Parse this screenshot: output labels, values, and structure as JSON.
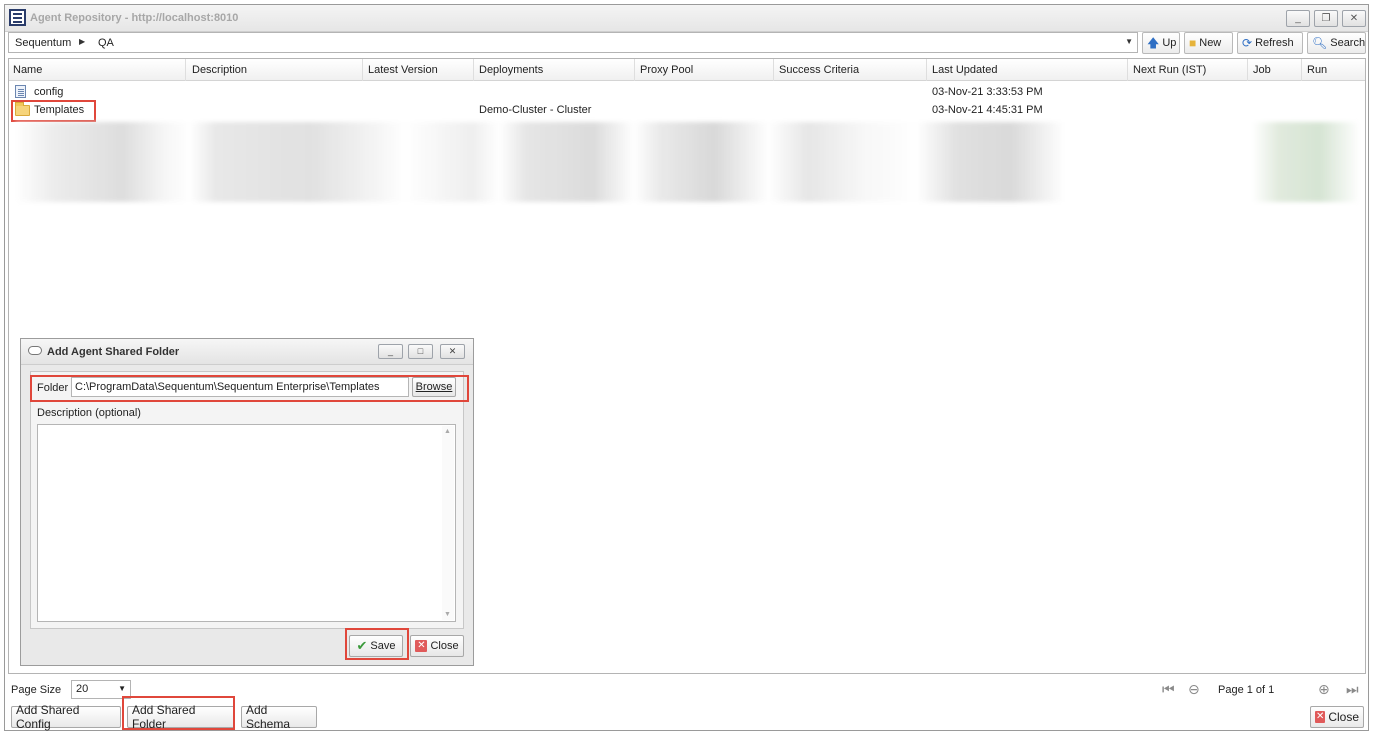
{
  "window": {
    "title": "Agent Repository - http://localhost:8010",
    "controls": [
      "_",
      "❐",
      "✕"
    ]
  },
  "breadcrumb": {
    "root": "Sequentum",
    "current": "QA"
  },
  "toolbar": {
    "up": "Up",
    "new": "New",
    "refresh": "Refresh",
    "search": "Search"
  },
  "grid": {
    "columns": [
      "Name",
      "Description",
      "Latest Version",
      "Deployments",
      "Proxy Pool",
      "Success Criteria",
      "Last Updated",
      "Next Run (IST)",
      "Job",
      "Run"
    ],
    "rows": [
      {
        "name": "config",
        "deployments": "",
        "last_updated": "03-Nov-21 3:33:53 PM",
        "icon": "file-icon"
      },
      {
        "name": "Templates",
        "deployments": "Demo-Cluster - Cluster",
        "last_updated": "03-Nov-21 4:45:31 PM",
        "icon": "folder-icon"
      }
    ]
  },
  "dialog": {
    "title": "Add Agent Shared Folder",
    "folder_label": "Folder",
    "folder_value": "C:\\ProgramData\\Sequentum\\Sequentum Enterprise\\Templates",
    "browse": "Browse",
    "description_label": "Description (optional)",
    "description_value": "",
    "save": "Save",
    "close": "Close"
  },
  "footer": {
    "page_size_label": "Page Size",
    "page_size_value": "20",
    "page_info": "Page 1 of 1",
    "add_shared_config": "Add Shared Config",
    "add_shared_folder": "Add Shared Folder",
    "add_schema": "Add Schema",
    "close": "Close"
  },
  "colors": {
    "highlight": "#e0473b",
    "accent": "#2a3c6a"
  }
}
